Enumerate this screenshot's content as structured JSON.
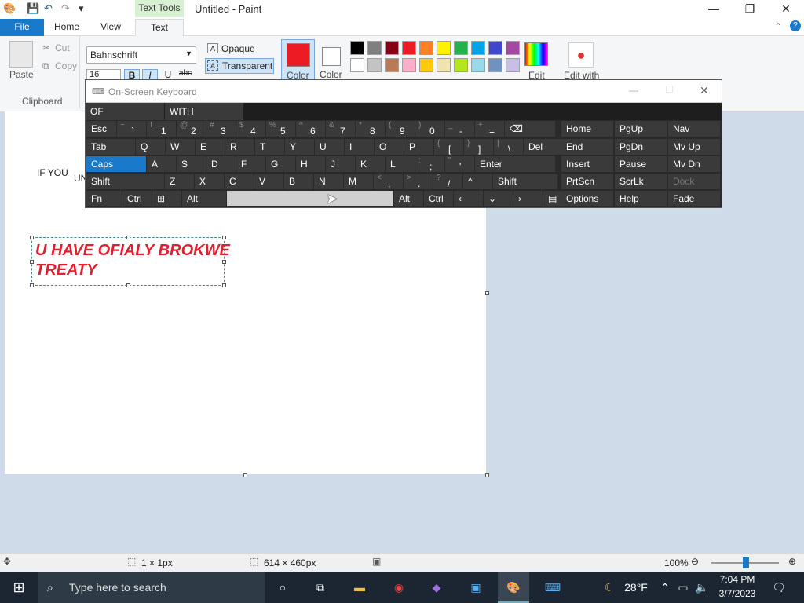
{
  "titlebar": {
    "context_tab": "Text Tools",
    "app_title": "Untitled - Paint",
    "minimize": "—",
    "restore": "❐",
    "close": "✕"
  },
  "tabs": {
    "file": "File",
    "home": "Home",
    "view": "View",
    "text": "Text"
  },
  "ribbon": {
    "paste": "Paste",
    "cut": "Cut",
    "copy": "Copy",
    "clipboard_group": "Clipboard",
    "font_name": "Bahnschrift",
    "font_size": "16",
    "bold": "B",
    "italic": "I",
    "underline": "U",
    "strike": "abc",
    "opaque": "Opaque",
    "transparent": "Transparent",
    "color1_label": "Color",
    "color2_label": "Color",
    "color1": "#ed1c24",
    "edit_colors": "Edit",
    "edit_with": "Edit with",
    "palette_row1": [
      "#000000",
      "#7f7f7f",
      "#880015",
      "#ed1c24",
      "#ff7f27",
      "#fff200",
      "#22b14c",
      "#00a2e8",
      "#3f48cc",
      "#a349a4"
    ],
    "palette_row2": [
      "#ffffff",
      "#c3c3c3",
      "#b97a57",
      "#ffaec9",
      "#ffc90e",
      "#efe4b0",
      "#b5e61d",
      "#99d9ea",
      "#7092be",
      "#c8bfe7"
    ]
  },
  "canvas": {
    "partial_text_1": "IF YOU",
    "partial_text_2": "UN",
    "textbox_content": "U HAVE OFIALY BROKWE\nTREATY "
  },
  "osk": {
    "title": "On-Screen Keyboard",
    "suggestions": [
      "OF",
      "WITH"
    ],
    "rows": [
      [
        {
          "l": "Esc"
        },
        {
          "l": "`",
          "s": "~"
        },
        {
          "l": "1",
          "s": "!"
        },
        {
          "l": "2",
          "s": "@"
        },
        {
          "l": "3",
          "s": "#"
        },
        {
          "l": "4",
          "s": "$"
        },
        {
          "l": "5",
          "s": "%"
        },
        {
          "l": "6",
          "s": "^"
        },
        {
          "l": "7",
          "s": "&"
        },
        {
          "l": "8",
          "s": "*"
        },
        {
          "l": "9",
          "s": "("
        },
        {
          "l": "0",
          "s": ")"
        },
        {
          "l": "-",
          "s": "_"
        },
        {
          "l": "=",
          "s": "+"
        },
        {
          "l": "⌫"
        }
      ],
      [
        {
          "l": "Tab"
        },
        {
          "l": "Q"
        },
        {
          "l": "W"
        },
        {
          "l": "E"
        },
        {
          "l": "R"
        },
        {
          "l": "T"
        },
        {
          "l": "Y"
        },
        {
          "l": "U"
        },
        {
          "l": "I"
        },
        {
          "l": "O"
        },
        {
          "l": "P"
        },
        {
          "l": "[",
          "s": "{"
        },
        {
          "l": "]",
          "s": "}"
        },
        {
          "l": "\\",
          "s": "|"
        },
        {
          "l": "Del"
        }
      ],
      [
        {
          "l": "Caps"
        },
        {
          "l": "A"
        },
        {
          "l": "S"
        },
        {
          "l": "D"
        },
        {
          "l": "F"
        },
        {
          "l": "G"
        },
        {
          "l": "H"
        },
        {
          "l": "J"
        },
        {
          "l": "K"
        },
        {
          "l": "L"
        },
        {
          "l": ";",
          "s": ":"
        },
        {
          "l": "'",
          "s": "\""
        },
        {
          "l": "Enter"
        }
      ],
      [
        {
          "l": "Shift"
        },
        {
          "l": "Z"
        },
        {
          "l": "X"
        },
        {
          "l": "C"
        },
        {
          "l": "V"
        },
        {
          "l": "B"
        },
        {
          "l": "N"
        },
        {
          "l": "M"
        },
        {
          "l": ",",
          "s": "<"
        },
        {
          "l": ".",
          "s": ">"
        },
        {
          "l": "/",
          "s": "?"
        },
        {
          "l": "^"
        },
        {
          "l": "Shift"
        }
      ],
      [
        {
          "l": "Fn"
        },
        {
          "l": "Ctrl"
        },
        {
          "l": "⊞"
        },
        {
          "l": "Alt"
        },
        {
          "l": ""
        },
        {
          "l": "Alt"
        },
        {
          "l": "Ctrl"
        },
        {
          "l": "‹"
        },
        {
          "l": "⌄"
        },
        {
          "l": "›"
        },
        {
          "l": "▤"
        }
      ]
    ],
    "nav": [
      [
        "Home",
        "PgUp",
        "Nav"
      ],
      [
        "End",
        "PgDn",
        "Mv Up"
      ],
      [
        "Insert",
        "Pause",
        "Mv Dn"
      ],
      [
        "PrtScn",
        "ScrLk",
        "Dock"
      ],
      [
        "Options",
        "Help",
        "Fade"
      ]
    ]
  },
  "status": {
    "selection": "1 × 1px",
    "canvas_size": "614 × 460px",
    "zoom": "100%"
  },
  "taskbar": {
    "search_placeholder": "Type here to search",
    "weather": "28°F",
    "time": "7:04 PM",
    "date": "3/7/2023"
  }
}
